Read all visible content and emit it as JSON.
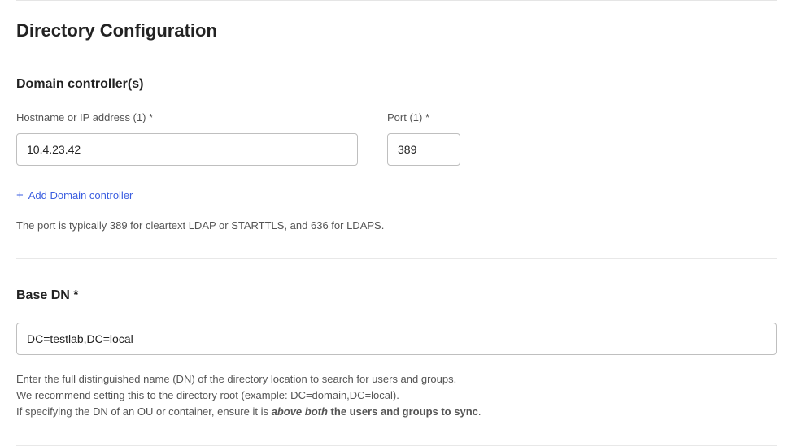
{
  "page": {
    "title": "Directory Configuration"
  },
  "domain_controllers": {
    "header": "Domain controller(s)",
    "hostname": {
      "label": "Hostname or IP address (1) *",
      "value": "10.4.23.42"
    },
    "port": {
      "label": "Port (1) *",
      "value": "389"
    },
    "add_label": "Add Domain controller",
    "help": "The port is typically 389 for cleartext LDAP or STARTTLS, and 636 for LDAPS."
  },
  "base_dn": {
    "header": "Base DN *",
    "value": "DC=testlab,DC=local",
    "help_line1": "Enter the full distinguished name (DN) of the directory location to search for users and groups.",
    "help_line2": "We recommend setting this to the directory root (example: DC=domain,DC=local).",
    "help_line3_pre": "If specifying the DN of an OU or container, ensure it is ",
    "help_line3_em": "above both",
    "help_line3_bold": " the users and groups to sync",
    "help_line3_end": "."
  }
}
